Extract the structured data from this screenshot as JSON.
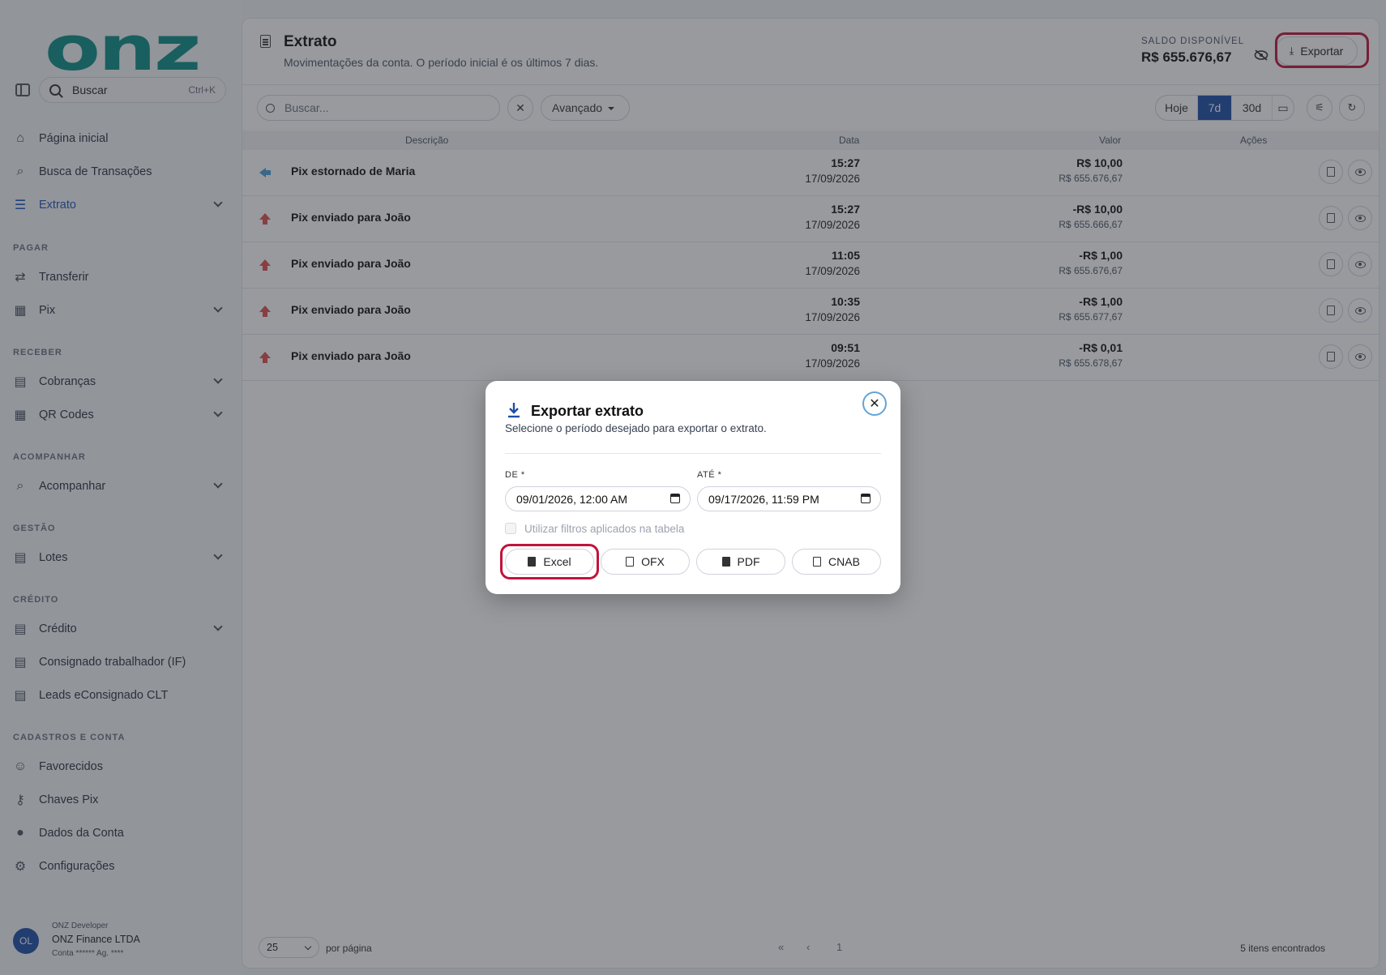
{
  "app": {
    "logo": "onz"
  },
  "sidebar": {
    "search": {
      "placeholder": "Buscar",
      "shortcut": "Ctrl+K"
    },
    "top_items": [
      {
        "label": "Página inicial",
        "icon": "home-icon"
      },
      {
        "label": "Busca de Transações",
        "icon": "search-icon"
      },
      {
        "label": "Extrato",
        "icon": "list-icon",
        "active": true
      }
    ],
    "sections": {
      "pagar": "PAGAR",
      "receber": "RECEBER",
      "acompanhar": "ACOMPANHAR",
      "gestao": "GESTÃO",
      "credito": "CRÉDITO",
      "cadastros": "CADASTROS E CONTA"
    },
    "items": {
      "transferir": "Transferir",
      "pix": "Pix",
      "cobrancas": "Cobranças",
      "qrcodes": "QR Codes",
      "acompanhar": "Acompanhar",
      "lotes": "Lotes",
      "credito": "Crédito",
      "consignado": "Consignado trabalhador (IF)",
      "leads": "Leads eConsignado CLT",
      "favorecidos": "Favorecidos",
      "chaves": "Chaves Pix",
      "dados": "Dados da Conta",
      "config": "Configurações"
    },
    "user": {
      "initials": "OL",
      "role": "ONZ Developer",
      "company": "ONZ Finance LTDA",
      "account": "Conta ****** Ag. ****"
    }
  },
  "header": {
    "title": "Extrato",
    "subtitle": "Movimentações da conta. O período inicial é os últimos 7 dias.",
    "balance_label": "SALDO DISPONÍVEL",
    "balance_value": "R$ 655.676,67",
    "export_label": "Exportar"
  },
  "toolbar": {
    "search_placeholder": "Buscar...",
    "clear": "✕",
    "advanced": "Avançado",
    "periods": [
      "Hoje",
      "7d",
      "30d"
    ],
    "selected_period": "7d"
  },
  "table": {
    "headers": {
      "desc": "Descrição",
      "date": "Data",
      "value": "Valor",
      "actions": "Ações"
    },
    "rows": [
      {
        "desc": "Pix estornado de Maria",
        "time": "15:27",
        "date": "17/09/2026",
        "value": "R$ 10,00",
        "balance": "R$ 655.676,67",
        "direction": "in",
        "color": "#4a9fd8"
      },
      {
        "desc": "Pix enviado para João",
        "time": "15:27",
        "date": "17/09/2026",
        "value": "-R$ 10,00",
        "balance": "R$ 655.666,67",
        "direction": "out",
        "color": "#e05252"
      },
      {
        "desc": "Pix enviado para João",
        "time": "11:05",
        "date": "17/09/2026",
        "value": "-R$ 1,00",
        "balance": "R$ 655.676,67",
        "direction": "out",
        "color": "#e05252"
      },
      {
        "desc": "Pix enviado para João",
        "time": "10:35",
        "date": "17/09/2026",
        "value": "-R$ 1,00",
        "balance": "R$ 655.677,67",
        "direction": "out",
        "color": "#e05252"
      },
      {
        "desc": "Pix enviado para João",
        "time": "09:51",
        "date": "17/09/2026",
        "value": "-R$ 0,01",
        "balance": "R$ 655.678,67",
        "direction": "out",
        "color": "#e05252"
      }
    ]
  },
  "pagination": {
    "page_size": "25",
    "per_page": "por página",
    "first": "«",
    "prev": "‹",
    "current": "1",
    "found": "5 itens encontrados"
  },
  "modal": {
    "title": "Exportar extrato",
    "subtitle": "Selecione o período desejado para exportar o extrato.",
    "from_label": "DE  *",
    "to_label": "ATÉ  *",
    "from_value": "09/01/2026, 12:00 AM",
    "to_value": "09/17/2026, 11:59 PM",
    "checkbox_label": "Utilizar filtros aplicados na tabela",
    "formats": [
      "Excel",
      "OFX",
      "PDF",
      "CNAB"
    ]
  },
  "colors": {
    "brand": "#0d8f86",
    "accent": "#1d4ea8",
    "highlight": "#c0143c"
  }
}
